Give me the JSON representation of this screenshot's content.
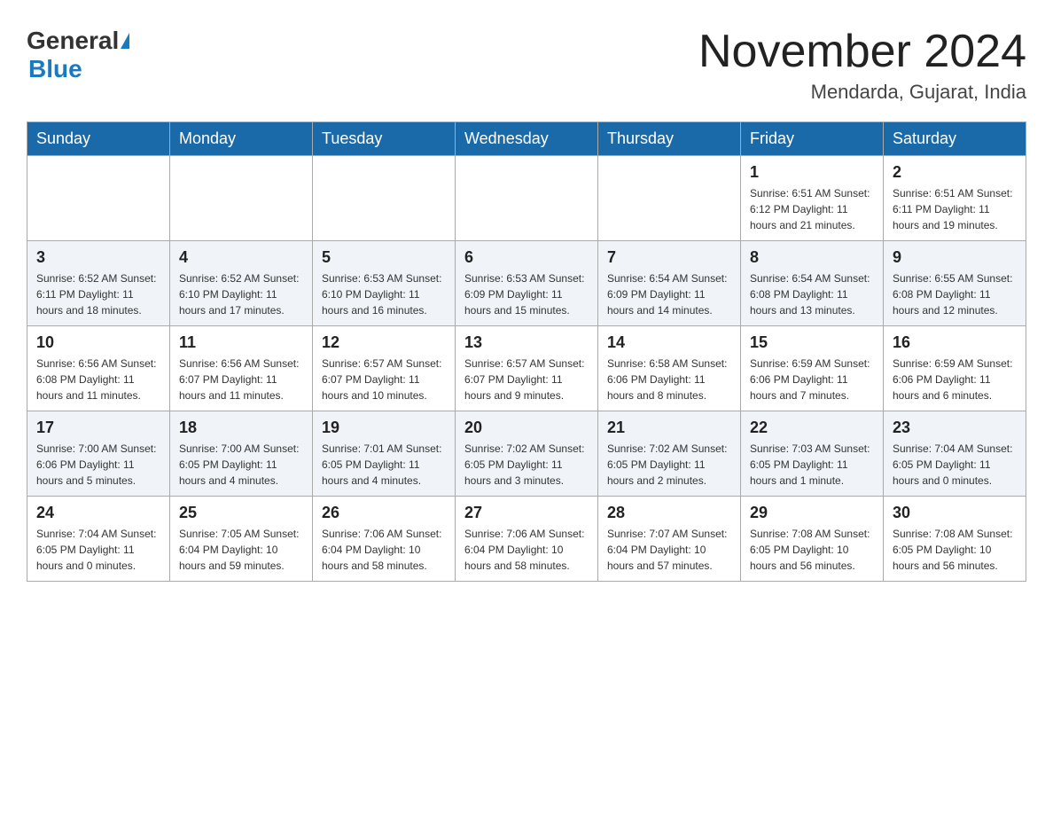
{
  "header": {
    "logo_general": "General",
    "logo_blue": "Blue",
    "month_title": "November 2024",
    "location": "Mendarda, Gujarat, India"
  },
  "weekdays": [
    "Sunday",
    "Monday",
    "Tuesday",
    "Wednesday",
    "Thursday",
    "Friday",
    "Saturday"
  ],
  "weeks": [
    [
      {
        "day": "",
        "info": ""
      },
      {
        "day": "",
        "info": ""
      },
      {
        "day": "",
        "info": ""
      },
      {
        "day": "",
        "info": ""
      },
      {
        "day": "",
        "info": ""
      },
      {
        "day": "1",
        "info": "Sunrise: 6:51 AM\nSunset: 6:12 PM\nDaylight: 11 hours and 21 minutes."
      },
      {
        "day": "2",
        "info": "Sunrise: 6:51 AM\nSunset: 6:11 PM\nDaylight: 11 hours and 19 minutes."
      }
    ],
    [
      {
        "day": "3",
        "info": "Sunrise: 6:52 AM\nSunset: 6:11 PM\nDaylight: 11 hours and 18 minutes."
      },
      {
        "day": "4",
        "info": "Sunrise: 6:52 AM\nSunset: 6:10 PM\nDaylight: 11 hours and 17 minutes."
      },
      {
        "day": "5",
        "info": "Sunrise: 6:53 AM\nSunset: 6:10 PM\nDaylight: 11 hours and 16 minutes."
      },
      {
        "day": "6",
        "info": "Sunrise: 6:53 AM\nSunset: 6:09 PM\nDaylight: 11 hours and 15 minutes."
      },
      {
        "day": "7",
        "info": "Sunrise: 6:54 AM\nSunset: 6:09 PM\nDaylight: 11 hours and 14 minutes."
      },
      {
        "day": "8",
        "info": "Sunrise: 6:54 AM\nSunset: 6:08 PM\nDaylight: 11 hours and 13 minutes."
      },
      {
        "day": "9",
        "info": "Sunrise: 6:55 AM\nSunset: 6:08 PM\nDaylight: 11 hours and 12 minutes."
      }
    ],
    [
      {
        "day": "10",
        "info": "Sunrise: 6:56 AM\nSunset: 6:08 PM\nDaylight: 11 hours and 11 minutes."
      },
      {
        "day": "11",
        "info": "Sunrise: 6:56 AM\nSunset: 6:07 PM\nDaylight: 11 hours and 11 minutes."
      },
      {
        "day": "12",
        "info": "Sunrise: 6:57 AM\nSunset: 6:07 PM\nDaylight: 11 hours and 10 minutes."
      },
      {
        "day": "13",
        "info": "Sunrise: 6:57 AM\nSunset: 6:07 PM\nDaylight: 11 hours and 9 minutes."
      },
      {
        "day": "14",
        "info": "Sunrise: 6:58 AM\nSunset: 6:06 PM\nDaylight: 11 hours and 8 minutes."
      },
      {
        "day": "15",
        "info": "Sunrise: 6:59 AM\nSunset: 6:06 PM\nDaylight: 11 hours and 7 minutes."
      },
      {
        "day": "16",
        "info": "Sunrise: 6:59 AM\nSunset: 6:06 PM\nDaylight: 11 hours and 6 minutes."
      }
    ],
    [
      {
        "day": "17",
        "info": "Sunrise: 7:00 AM\nSunset: 6:06 PM\nDaylight: 11 hours and 5 minutes."
      },
      {
        "day": "18",
        "info": "Sunrise: 7:00 AM\nSunset: 6:05 PM\nDaylight: 11 hours and 4 minutes."
      },
      {
        "day": "19",
        "info": "Sunrise: 7:01 AM\nSunset: 6:05 PM\nDaylight: 11 hours and 4 minutes."
      },
      {
        "day": "20",
        "info": "Sunrise: 7:02 AM\nSunset: 6:05 PM\nDaylight: 11 hours and 3 minutes."
      },
      {
        "day": "21",
        "info": "Sunrise: 7:02 AM\nSunset: 6:05 PM\nDaylight: 11 hours and 2 minutes."
      },
      {
        "day": "22",
        "info": "Sunrise: 7:03 AM\nSunset: 6:05 PM\nDaylight: 11 hours and 1 minute."
      },
      {
        "day": "23",
        "info": "Sunrise: 7:04 AM\nSunset: 6:05 PM\nDaylight: 11 hours and 0 minutes."
      }
    ],
    [
      {
        "day": "24",
        "info": "Sunrise: 7:04 AM\nSunset: 6:05 PM\nDaylight: 11 hours and 0 minutes."
      },
      {
        "day": "25",
        "info": "Sunrise: 7:05 AM\nSunset: 6:04 PM\nDaylight: 10 hours and 59 minutes."
      },
      {
        "day": "26",
        "info": "Sunrise: 7:06 AM\nSunset: 6:04 PM\nDaylight: 10 hours and 58 minutes."
      },
      {
        "day": "27",
        "info": "Sunrise: 7:06 AM\nSunset: 6:04 PM\nDaylight: 10 hours and 58 minutes."
      },
      {
        "day": "28",
        "info": "Sunrise: 7:07 AM\nSunset: 6:04 PM\nDaylight: 10 hours and 57 minutes."
      },
      {
        "day": "29",
        "info": "Sunrise: 7:08 AM\nSunset: 6:05 PM\nDaylight: 10 hours and 56 minutes."
      },
      {
        "day": "30",
        "info": "Sunrise: 7:08 AM\nSunset: 6:05 PM\nDaylight: 10 hours and 56 minutes."
      }
    ]
  ]
}
